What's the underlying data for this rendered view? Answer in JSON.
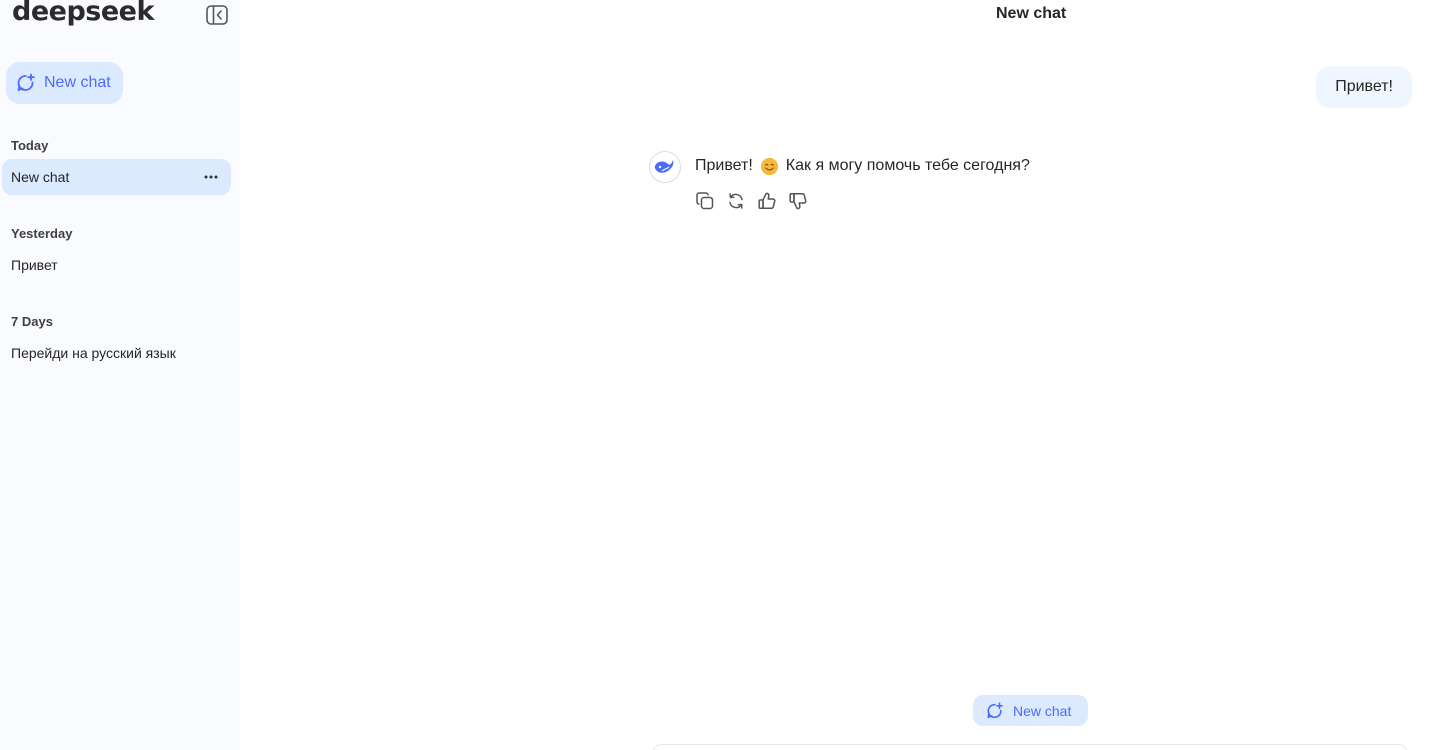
{
  "sidebar": {
    "logo": "deepseek",
    "new_chat_label": "New chat",
    "sections": [
      {
        "label": "Today",
        "items": [
          {
            "title": "New chat",
            "active": true
          }
        ]
      },
      {
        "label": "Yesterday",
        "items": [
          {
            "title": "Привет",
            "active": false
          }
        ]
      },
      {
        "label": "7 Days",
        "items": [
          {
            "title": "Перейди на русский язык",
            "active": false
          }
        ]
      }
    ]
  },
  "header": {
    "title": "New chat"
  },
  "conversation": {
    "user_message": "Привет!",
    "assistant_message_part1": "Привет!",
    "assistant_emoji": "smiling-face-emoji",
    "assistant_message_part2": "Как я могу помочь тебе сегодня?"
  },
  "actions": [
    "copy-icon",
    "regenerate-icon",
    "thumbs-up-icon",
    "thumbs-down-icon"
  ],
  "footer": {
    "new_chat_label": "New chat"
  },
  "colors": {
    "accent": "#4d6bfe",
    "accent_bg": "#dbeafe",
    "sidebar_bg": "#f9fbff",
    "user_bubble": "#eff6ff"
  }
}
